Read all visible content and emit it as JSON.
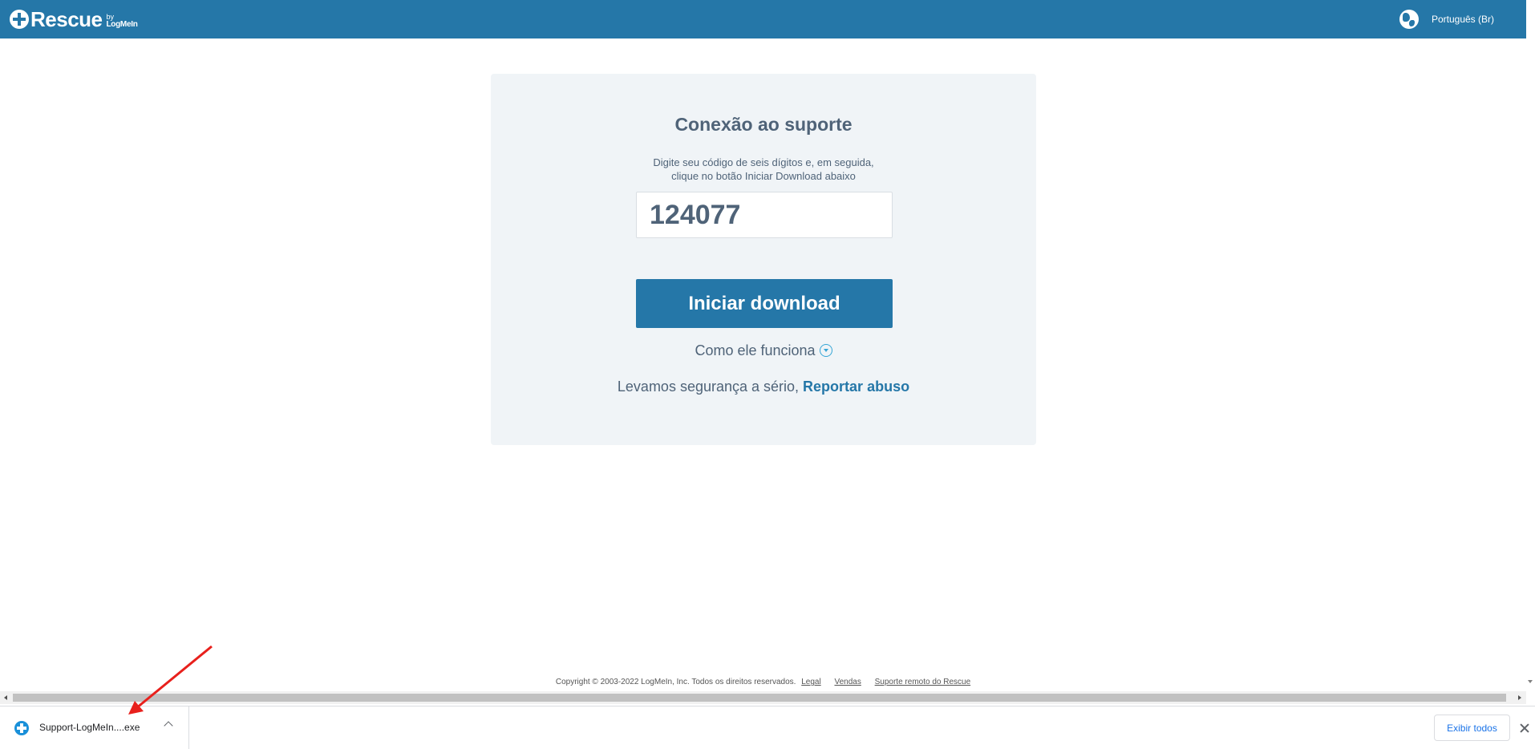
{
  "header": {
    "logo_text": "Rescue",
    "logo_by": "by",
    "logo_brand": "LogMeIn",
    "language_icon": "globe-icon",
    "language_label": "Português (Br)"
  },
  "card": {
    "title": "Conexão ao suporte",
    "instructions_line1": "Digite seu código de seis dígitos e, em seguida,",
    "instructions_line2": "clique no botão Iniciar Download abaixo",
    "code_value": "124077",
    "download_button_label": "Iniciar download",
    "how_it_works_label": "Como ele funciona",
    "how_it_works_icon": "chevron-down-circle-icon",
    "security_text": "Levamos segurança a sério, ",
    "report_abuse_label": "Reportar abuso"
  },
  "footer": {
    "copyright": "Copyright © 2003-2022 LogMeIn, Inc. Todos os direitos reservados.",
    "links": [
      "Legal",
      "Vendas",
      "Suporte remoto do Rescue"
    ]
  },
  "download_bar": {
    "file_icon": "rescue-plus-icon",
    "file_name": "Support-LogMeIn....exe",
    "show_all_label": "Exibir todos",
    "close_icon": "close-icon"
  },
  "colors": {
    "brand": "#2577a8",
    "card_background": "#f0f4f7",
    "text": "#4f6378",
    "annotation_arrow": "#e8201c"
  }
}
